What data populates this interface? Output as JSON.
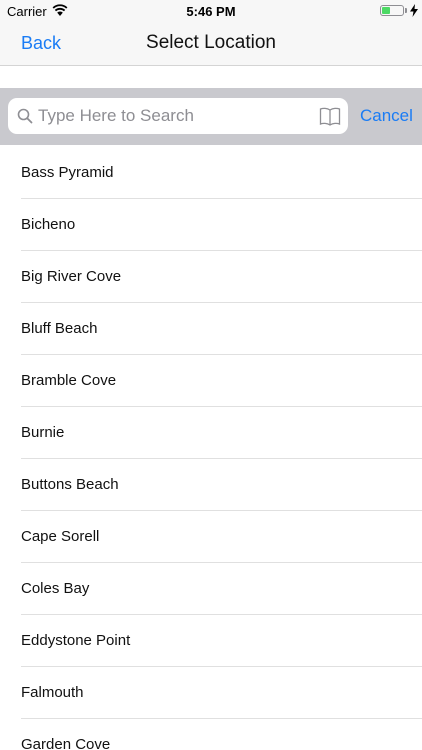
{
  "status_bar": {
    "carrier": "Carrier",
    "time": "5:46 PM",
    "battery_level": 0.4,
    "battery_color": "#4cd964"
  },
  "nav": {
    "back_label": "Back",
    "title": "Select Location",
    "accent_color": "#1a7cf5"
  },
  "search": {
    "placeholder": "Type Here to Search",
    "value": "",
    "cancel_label": "Cancel",
    "icons": [
      "search-icon",
      "book-icon"
    ]
  },
  "locations": [
    "Bass Pyramid",
    "Bicheno",
    "Big River Cove",
    "Bluff Beach",
    "Bramble Cove",
    "Burnie",
    "Buttons Beach",
    "Cape Sorell",
    "Coles Bay",
    "Eddystone Point",
    "Falmouth",
    "Garden Cove"
  ]
}
